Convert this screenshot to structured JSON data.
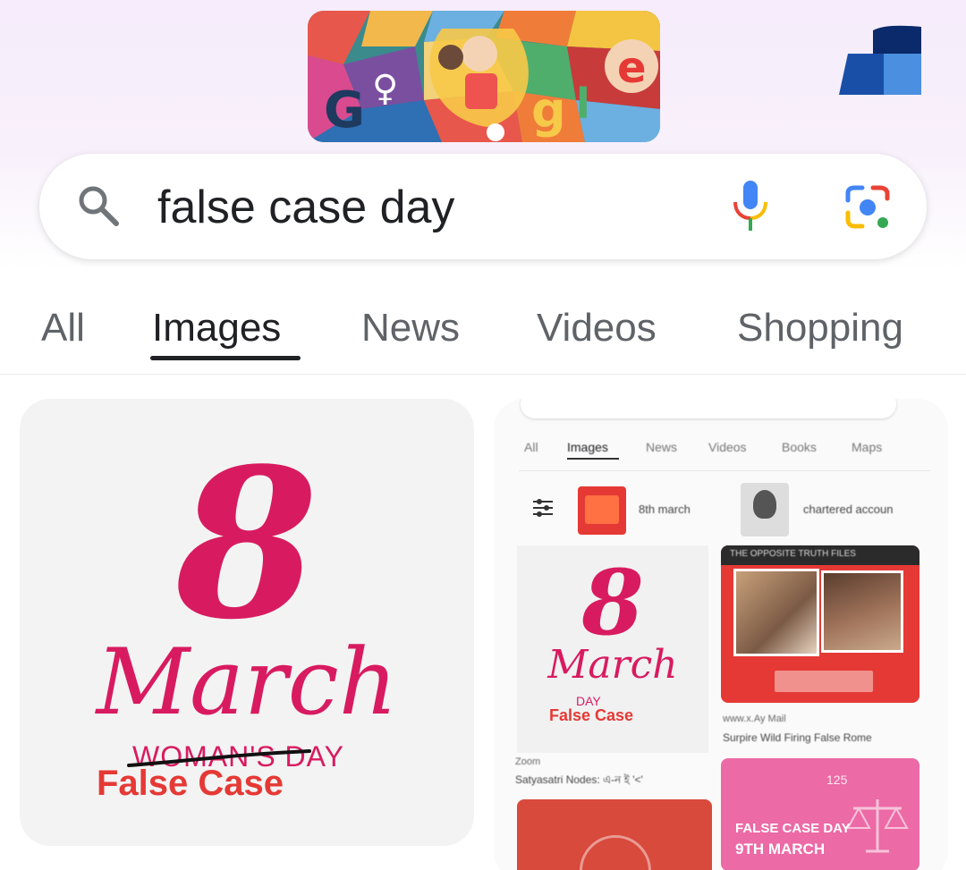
{
  "search": {
    "query": "false case day"
  },
  "tabs": [
    {
      "label": "All"
    },
    {
      "label": "Images"
    },
    {
      "label": "News"
    },
    {
      "label": "Videos"
    },
    {
      "label": "Shopping"
    }
  ],
  "results": [
    {
      "big_number": "8",
      "month": "March",
      "struck_text": "WOMAN'S DAY",
      "caption": "False Case"
    },
    {
      "mini_screenshot": {
        "tabs": [
          "All",
          "Images",
          "News",
          "Videos",
          "Books",
          "Maps"
        ],
        "chips": [
          "8th march",
          "chartered accoun"
        ],
        "left_image": {
          "big_number": "8",
          "month": "March",
          "struck_text": "DAY",
          "caption": "False Case"
        },
        "left_source": "Zoom",
        "left_title": "Satyasatri Nodes: এ-ন ই '<'",
        "right_banner": "THE OPPOSITE TRUTH FILES",
        "right_source": "www.x.Ay Mail",
        "right_title": "Surpire Wild Firing False Rome",
        "pink_image": {
          "line1": "FALSE CASE DAY",
          "line2": "9TH MARCH",
          "corner": "125"
        }
      }
    }
  ],
  "colors": {
    "accent_pink": "#d81b60",
    "false_case_red": "#e53935",
    "tab_active": "#202124",
    "tab_inactive": "#5f6368"
  },
  "icons": {
    "search": "search-icon",
    "mic": "microphone-icon",
    "lens": "google-lens-icon"
  }
}
